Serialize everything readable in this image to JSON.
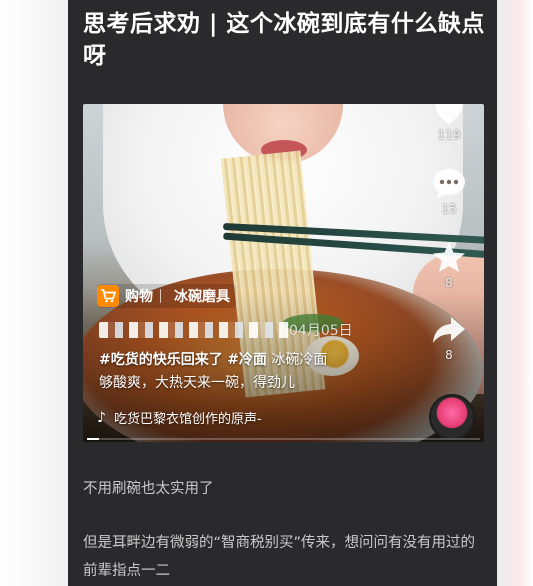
{
  "article": {
    "title": "思考后求劝 | 这个冰碗到底有什么缺点呀",
    "paragraph1": "不用刷碗也太实用了",
    "paragraph2": "但是耳畔边有微弱的“智商税别买”传来，想问问有没有用过的前辈指点一二"
  },
  "video": {
    "actions": {
      "likes": "119",
      "comments": "15",
      "favorites": "8",
      "shares": "8"
    },
    "shop_tag": {
      "label": "购物",
      "product": "冰碗磨具"
    },
    "date": "04月05日",
    "caption_hashtag1": "#吃货的快乐回来了",
    "caption_hashtag2": "#冷面",
    "caption_text1": "冰碗冷面",
    "caption_text2": "够酸爽，大热天来一碗，得劲儿",
    "music": "吃货巴黎衣馆创作的原声-",
    "progress": 0.03
  },
  "colors": {
    "card_bg": "#2a2a2c",
    "shop_orange": "#ff8a00",
    "text_gray": "#c9c9c9"
  },
  "icons": [
    "heart-icon",
    "comment-icon",
    "star-icon",
    "share-icon",
    "cart-icon",
    "music-note-icon"
  ]
}
